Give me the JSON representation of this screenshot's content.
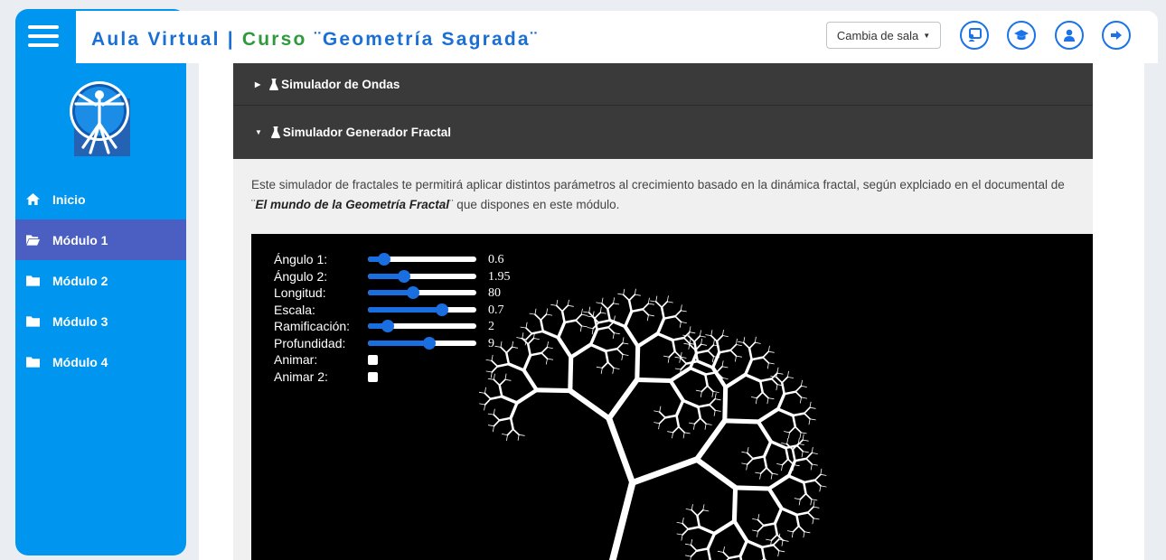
{
  "header": {
    "title_part1": "Aula Virtual",
    "separator": "|",
    "title_part2": "Curso",
    "course_name": "¨Geometría Sagrada¨",
    "room_select": "Cambia de sala"
  },
  "header_buttons": [
    "classroom-icon",
    "graduation-cap-icon",
    "user-icon",
    "logout-icon"
  ],
  "sidebar": {
    "items": [
      {
        "label": "Inicio",
        "icon": "home-icon",
        "active": false
      },
      {
        "label": "Módulo 1",
        "icon": "folder-open-icon",
        "active": true
      },
      {
        "label": "Módulo 2",
        "icon": "folder-icon",
        "active": false
      },
      {
        "label": "Módulo 3",
        "icon": "folder-icon",
        "active": false
      },
      {
        "label": "Módulo 4",
        "icon": "folder-icon",
        "active": false
      }
    ]
  },
  "accordions": [
    {
      "title": "Simulador de Ondas",
      "expanded": false
    },
    {
      "title": "Simulador Generador Fractal",
      "expanded": true
    }
  ],
  "description": {
    "text1": "Este simulador de fractales te permitirá aplicar distintos parámetros al crecimiento basado en la dinámica fractal, según explciado en el documental de ¨",
    "emphasis": "El mundo de la Geometría Fractal",
    "text2": "¨ que dispones en este módulo."
  },
  "simulator": {
    "sliders": [
      {
        "label": "Ángulo 1:",
        "value": "0.6",
        "level": 0.15
      },
      {
        "label": "Ángulo 2:",
        "value": "1.95",
        "level": 0.33
      },
      {
        "label": "Longitud:",
        "value": "80",
        "level": 0.42
      },
      {
        "label": "Escala:",
        "value": "0.7",
        "level": 0.68
      },
      {
        "label": "Ramificación:",
        "value": "2",
        "level": 0.18
      },
      {
        "label": "Profundidad:",
        "value": "9",
        "level": 0.57
      }
    ],
    "checkboxes": [
      {
        "label": "Animar:",
        "checked": false
      },
      {
        "label": "Animar 2:",
        "checked": false
      }
    ]
  },
  "colors": {
    "sidebar": "#0096f0",
    "sidebar_active": "#4a5fc1",
    "title_blue": "#1a6fd4",
    "title_green": "#2f9a3b",
    "accordion": "#3a3a3a",
    "slider_accent": "#1a6fe0"
  }
}
